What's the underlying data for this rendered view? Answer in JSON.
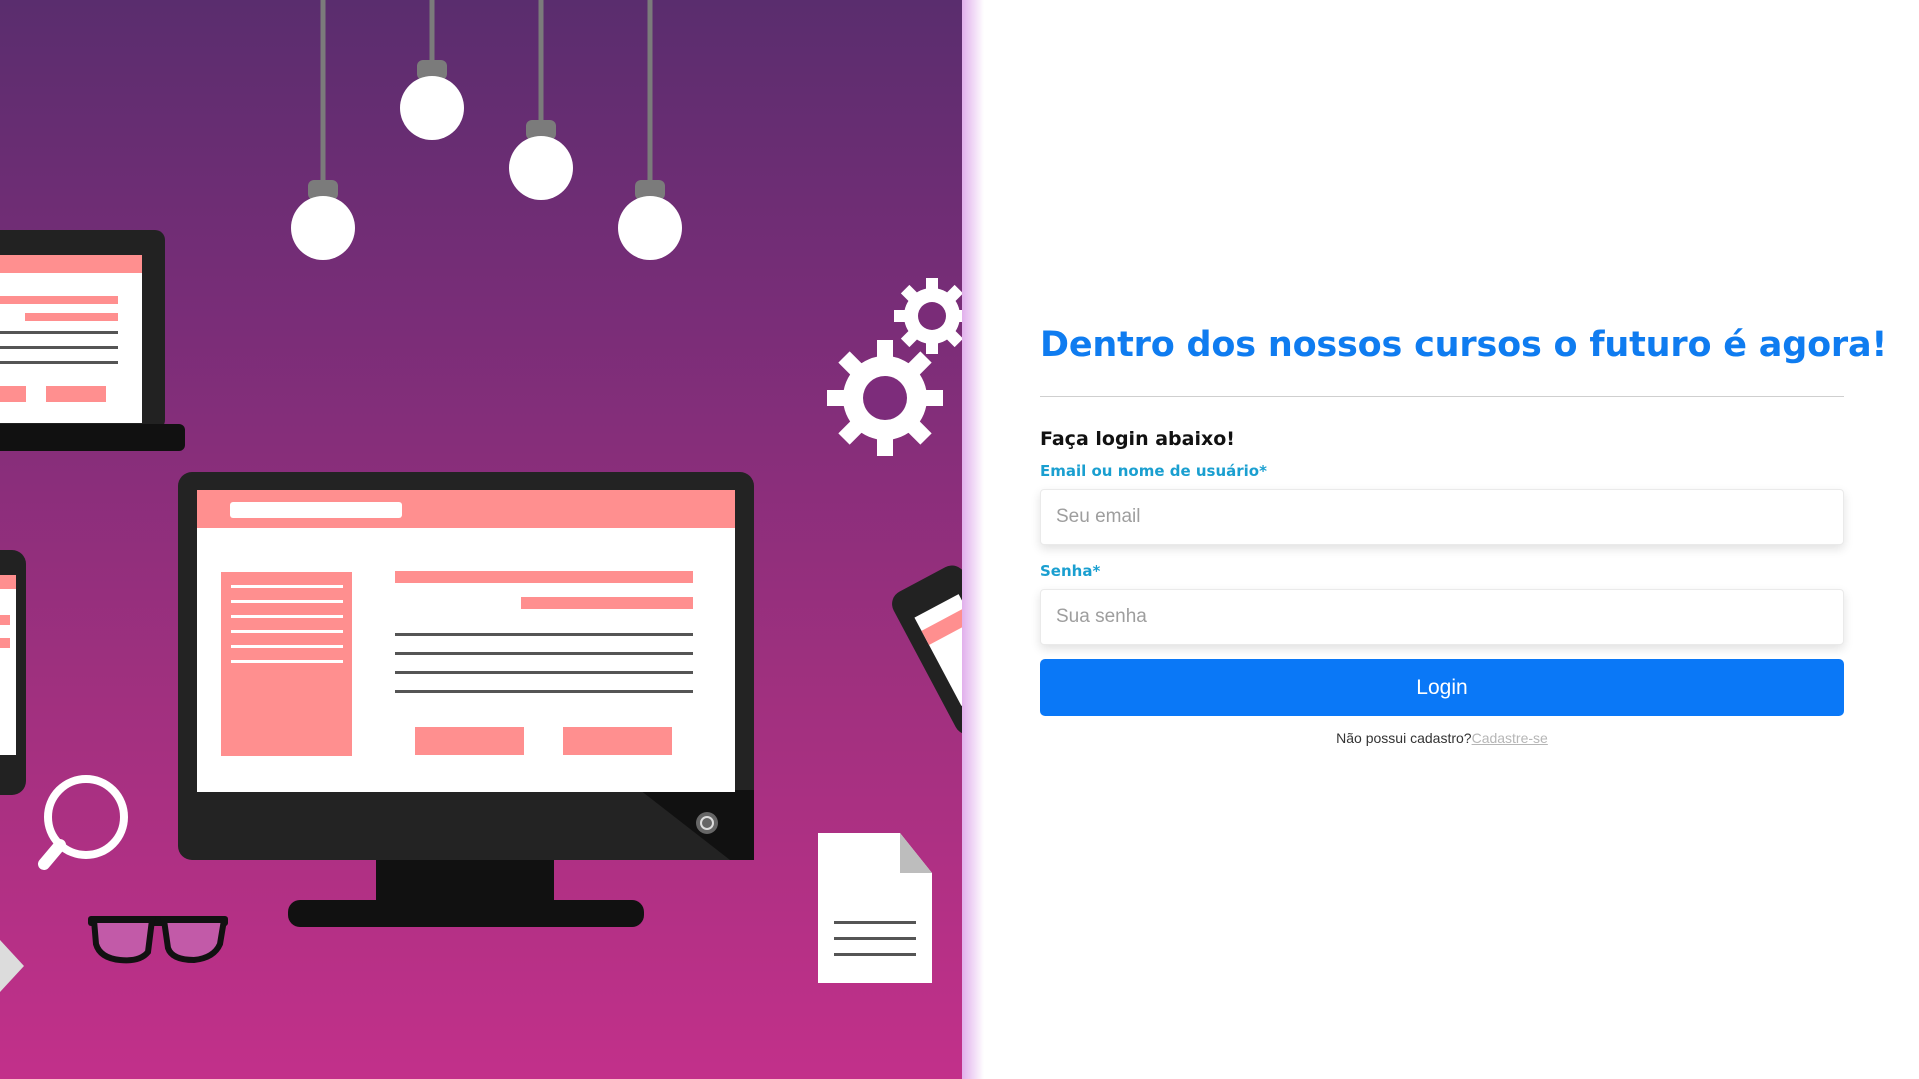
{
  "hero": {
    "description_icons": [
      "bulb-icon",
      "gear-icon",
      "monitor-icon",
      "laptop-icon",
      "tablet-icon",
      "magnifier-icon",
      "glasses-icon",
      "document-icon"
    ]
  },
  "login": {
    "title": "Dentro dos nossos cursos o futuro é agora!",
    "subtitle": "Faça login abaixo!",
    "email_label": "Email ou nome de usuário*",
    "email_placeholder": "Seu email",
    "password_label": "Senha*",
    "password_placeholder": "Sua senha",
    "button_label": "Login",
    "signup_text": "Não possui cadastro?",
    "signup_link": "Cadastre-se"
  },
  "colors": {
    "title": "#0f7cf0",
    "label": "#1a9fd0",
    "button": "#0a78f7",
    "hero_top": "#5a2d6e",
    "hero_bottom": "#c2308a",
    "accent_pink": "#ff8f8f"
  }
}
